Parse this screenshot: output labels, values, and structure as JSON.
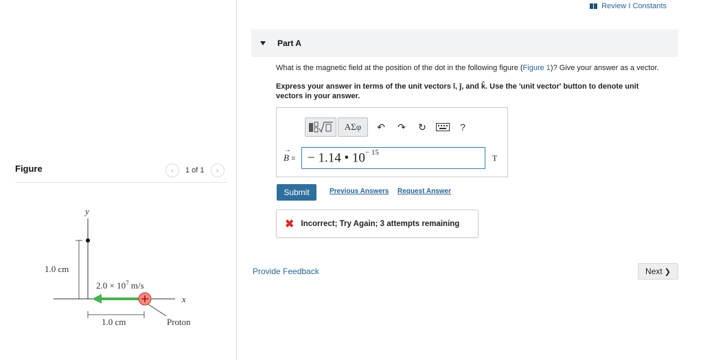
{
  "header": {
    "review_link": "Review I Constants"
  },
  "figure_panel": {
    "title": "Figure",
    "pager": {
      "prev_icon": "‹",
      "text": "1 of 1",
      "next_icon": "›"
    },
    "diagram": {
      "y_axis_label": "y",
      "x_axis_label": "x",
      "vertical_distance": "1.0 cm",
      "horizontal_distance": "1.0 cm",
      "velocity_label": "2.0 × 10",
      "velocity_exponent": "7",
      "velocity_unit": " m/s",
      "particle_label": "Proton",
      "arrow_color": "#4caf50",
      "proton_color": "#e57373"
    }
  },
  "part": {
    "title": "Part A",
    "question_prefix": "What is the magnetic field at the position of the dot in the following figure (",
    "figure_link": "Figure 1",
    "question_suffix": ")? Give your answer as a vector.",
    "instruction": "Express your answer in terms of the unit vectors î, ĵ, and k̂. Use the 'unit vector' button to denote unit vectors in your answer."
  },
  "answer": {
    "toolbar": {
      "templates_icon": "templates-icon",
      "greek_label": "ΑΣφ",
      "undo_icon": "↶",
      "redo_icon": "↷",
      "reset_icon": "↻",
      "keyboard_icon": "keyboard-icon",
      "help_label": "?"
    },
    "label": "B",
    "label_suffix": " =",
    "value_mantissa": "− 1.14 • 10",
    "value_exponent": "− 15",
    "unit": "T"
  },
  "actions": {
    "submit_label": "Submit",
    "previous_answers": "Previous Answers",
    "request_answer": "Request Answer"
  },
  "feedback": {
    "icon": "✖",
    "message": "Incorrect; Try Again; 3 attempts remaining"
  },
  "footer": {
    "provide_feedback": "Provide Feedback",
    "next_label": "Next",
    "next_icon": "❯"
  }
}
